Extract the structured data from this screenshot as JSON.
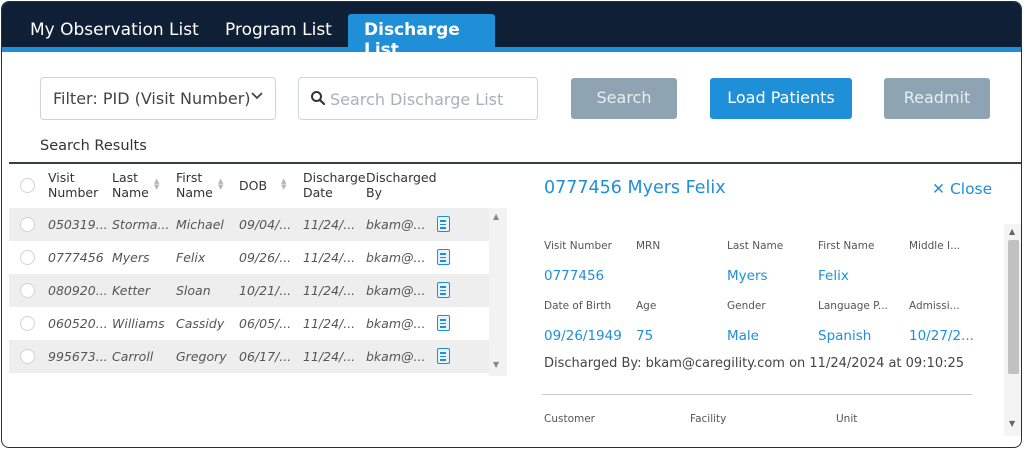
{
  "tabs": [
    {
      "label": "My Observation List",
      "active": false
    },
    {
      "label": "Program List",
      "active": false
    },
    {
      "label": "Discharge List",
      "active": true
    }
  ],
  "toolbar": {
    "filter_label": "Filter: PID (Visit Number)",
    "filter_icon": "chevron-down-icon",
    "search_placeholder": "Search Discharge List",
    "search_button": "Search",
    "load_button": "Load Patients",
    "readmit_button": "Readmit"
  },
  "results": {
    "label": "Search Results",
    "columns": [
      [
        "Visit",
        "Number"
      ],
      [
        "Last",
        "Name"
      ],
      [
        "First",
        "Name"
      ],
      [
        "DOB",
        ""
      ],
      [
        "Discharge",
        "Date"
      ],
      [
        "Discharged",
        "By"
      ]
    ],
    "rows": [
      {
        "visit": "050319...",
        "last": "Storma...",
        "first": "Michael",
        "dob": "09/04/...",
        "date": "11/24/...",
        "by": "bkam@..."
      },
      {
        "visit": "0777456",
        "last": "Myers",
        "first": "Felix",
        "dob": "09/26/...",
        "date": "11/24/...",
        "by": "bkam@..."
      },
      {
        "visit": "080920...",
        "last": "Ketter",
        "first": "Sloan",
        "dob": "10/21/...",
        "date": "11/24/...",
        "by": "bkam@..."
      },
      {
        "visit": "060520...",
        "last": "Williams",
        "first": "Cassidy",
        "dob": "06/05/...",
        "date": "11/24/...",
        "by": "bkam@..."
      },
      {
        "visit": "995673...",
        "last": "Carroll",
        "first": "Gregory",
        "dob": "06/17/...",
        "date": "11/24/...",
        "by": "bkam@..."
      }
    ]
  },
  "detail": {
    "title": "0777456 Myers Felix",
    "close_label": "Close",
    "labels_row1": [
      "Visit Number",
      "MRN",
      "Last Name",
      "First Name",
      "Middle I..."
    ],
    "values_row1": [
      "0777456",
      "",
      "Myers",
      "Felix",
      ""
    ],
    "labels_row2": [
      "Date of Birth",
      "Age",
      "Gender",
      "Language P...",
      "Admissi..."
    ],
    "values_row2": [
      "09/26/1949",
      "75",
      "Male",
      "Spanish",
      "10/27/2..."
    ],
    "discharged_by": "Discharged By: bkam@caregility.com on 11/24/2024 at 09:10:25",
    "labels_row3": [
      "Customer",
      "Facility",
      "Unit"
    ]
  },
  "colors": {
    "nav_bg": "#0f2036",
    "accent": "#1f8fd8",
    "disabled_button": "#8fa4b3"
  }
}
